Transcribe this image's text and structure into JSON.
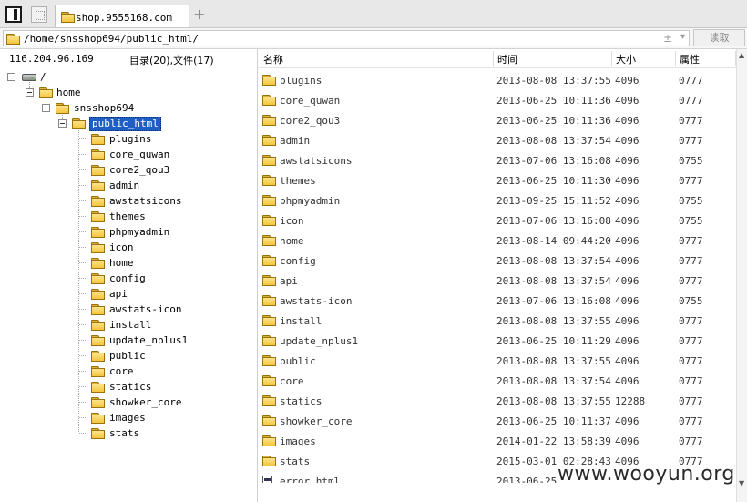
{
  "tab": {
    "title": "shop.9555168.com",
    "add_icon": "+"
  },
  "path": {
    "value": "/home/snsshop694/public_html/",
    "sort_glyph": "±",
    "dropdown_glyph": "▾",
    "read_button": "读取"
  },
  "info": {
    "ip": "116.204.96.169",
    "counts": "目录(20),文件(17)"
  },
  "columns": {
    "name": "名称",
    "time": "时间",
    "size": "大小",
    "perm": "属性"
  },
  "tree": {
    "root": "/",
    "home": "home",
    "user": "snsshop694",
    "selected": "public_html",
    "children": [
      "plugins",
      "core_quwan",
      "core2_qou3",
      "admin",
      "awstatsicons",
      "themes",
      "phpmyadmin",
      "icon",
      "home",
      "config",
      "api",
      "awstats-icon",
      "install",
      "update_nplus1",
      "public",
      "core",
      "statics",
      "showker_core",
      "images",
      "stats"
    ]
  },
  "files": [
    {
      "name": "plugins",
      "time": "2013-08-08 13:37:55",
      "size": "4096",
      "perm": "0777"
    },
    {
      "name": "core_quwan",
      "time": "2013-06-25 10:11:36",
      "size": "4096",
      "perm": "0777"
    },
    {
      "name": "core2_qou3",
      "time": "2013-06-25 10:11:36",
      "size": "4096",
      "perm": "0777"
    },
    {
      "name": "admin",
      "time": "2013-08-08 13:37:54",
      "size": "4096",
      "perm": "0777"
    },
    {
      "name": "awstatsicons",
      "time": "2013-07-06 13:16:08",
      "size": "4096",
      "perm": "0755"
    },
    {
      "name": "themes",
      "time": "2013-06-25 10:11:30",
      "size": "4096",
      "perm": "0777"
    },
    {
      "name": "phpmyadmin",
      "time": "2013-09-25 15:11:52",
      "size": "4096",
      "perm": "0755"
    },
    {
      "name": "icon",
      "time": "2013-07-06 13:16:08",
      "size": "4096",
      "perm": "0755"
    },
    {
      "name": "home",
      "time": "2013-08-14 09:44:20",
      "size": "4096",
      "perm": "0777"
    },
    {
      "name": "config",
      "time": "2013-08-08 13:37:54",
      "size": "4096",
      "perm": "0777"
    },
    {
      "name": "api",
      "time": "2013-08-08 13:37:54",
      "size": "4096",
      "perm": "0777"
    },
    {
      "name": "awstats-icon",
      "time": "2013-07-06 13:16:08",
      "size": "4096",
      "perm": "0755"
    },
    {
      "name": "install",
      "time": "2013-08-08 13:37:55",
      "size": "4096",
      "perm": "0777"
    },
    {
      "name": "update_nplus1",
      "time": "2013-06-25 10:11:29",
      "size": "4096",
      "perm": "0777"
    },
    {
      "name": "public",
      "time": "2013-08-08 13:37:55",
      "size": "4096",
      "perm": "0777"
    },
    {
      "name": "core",
      "time": "2013-08-08 13:37:54",
      "size": "4096",
      "perm": "0777"
    },
    {
      "name": "statics",
      "time": "2013-08-08 13:37:55",
      "size": "12288",
      "perm": "0777"
    },
    {
      "name": "showker_core",
      "time": "2013-06-25 10:11:37",
      "size": "4096",
      "perm": "0777"
    },
    {
      "name": "images",
      "time": "2014-01-22 13:58:39",
      "size": "4096",
      "perm": "0777"
    },
    {
      "name": "stats",
      "time": "2015-03-01 02:28:43",
      "size": "4096",
      "perm": "0777"
    },
    {
      "name": "error.html",
      "time": "2013-06-25",
      "size": "",
      "perm": "",
      "type": "file"
    }
  ],
  "watermark": "www.wooyun.org",
  "colors": {
    "selection": "#1f5fc4",
    "folder": "#f5c53c"
  }
}
